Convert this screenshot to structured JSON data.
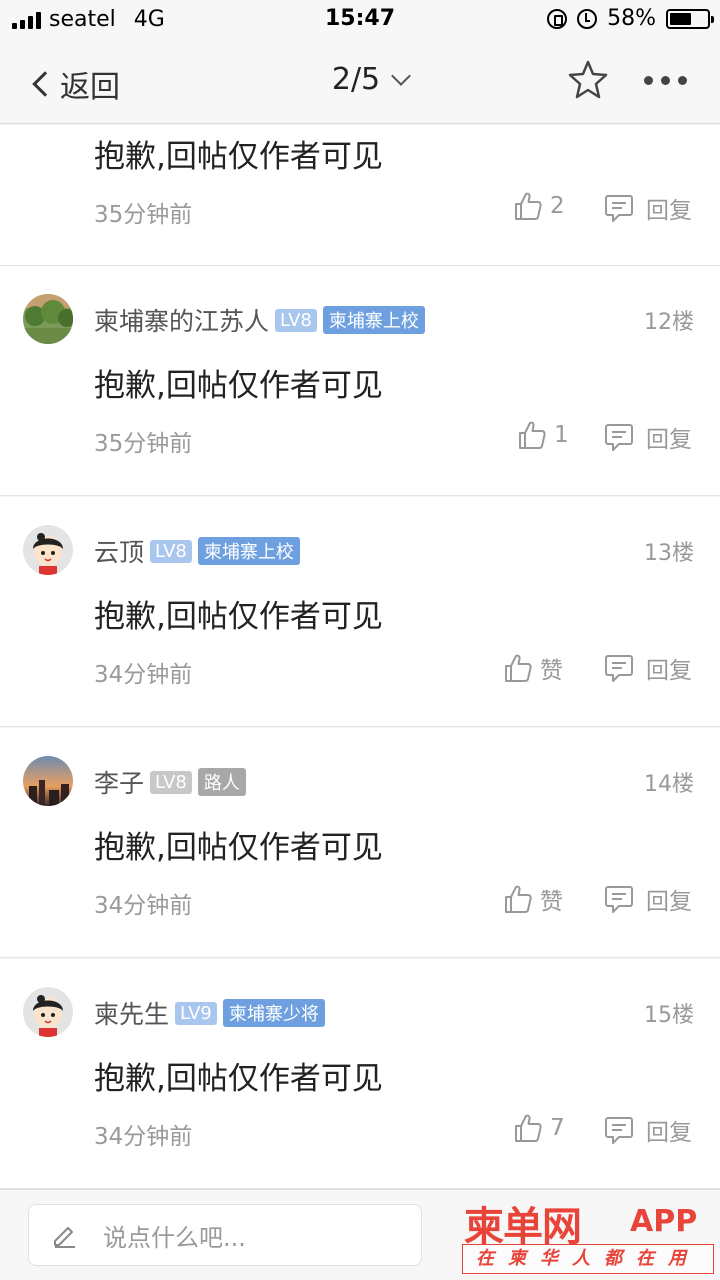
{
  "status_bar": {
    "carrier": "seatel",
    "network": "4G",
    "time": "15:47",
    "battery": "58%",
    "battery_level": 0.58
  },
  "nav": {
    "back_label": "返回",
    "page_indicator": "2/5"
  },
  "posts": [
    {
      "content": "抱歉,回帖仅作者可见",
      "time": "35分钟前",
      "like": "2",
      "reply": "回复"
    },
    {
      "username": "柬埔寨的江苏人",
      "level": "LV8",
      "title": "柬埔寨上校",
      "floor": "12楼",
      "content": "抱歉,回帖仅作者可见",
      "time": "35分钟前",
      "like": "1",
      "reply": "回复"
    },
    {
      "username": "云顶",
      "level": "LV8",
      "title": "柬埔寨上校",
      "floor": "13楼",
      "content": "抱歉,回帖仅作者可见",
      "time": "34分钟前",
      "like": "赞",
      "reply": "回复"
    },
    {
      "username": "李子",
      "level": "LV8",
      "title": "路人",
      "floor": "14楼",
      "content": "抱歉,回帖仅作者可见",
      "time": "34分钟前",
      "like": "赞",
      "reply": "回复"
    },
    {
      "username": "柬先生",
      "level": "LV9",
      "title": "柬埔寨少将",
      "floor": "15楼",
      "content": "抱歉,回帖仅作者可见",
      "time": "34分钟前",
      "like": "7",
      "reply": "回复"
    }
  ],
  "bottom": {
    "comment_placeholder": "说点什么吧...",
    "watermark_title": "柬单网",
    "watermark_app": "APP",
    "watermark_slogan": "在柬华人都在用"
  },
  "colors": {
    "accent_blue": "#6ea0e0",
    "level_blue": "#a9c6ee",
    "watermark_red": "#e8443a"
  }
}
